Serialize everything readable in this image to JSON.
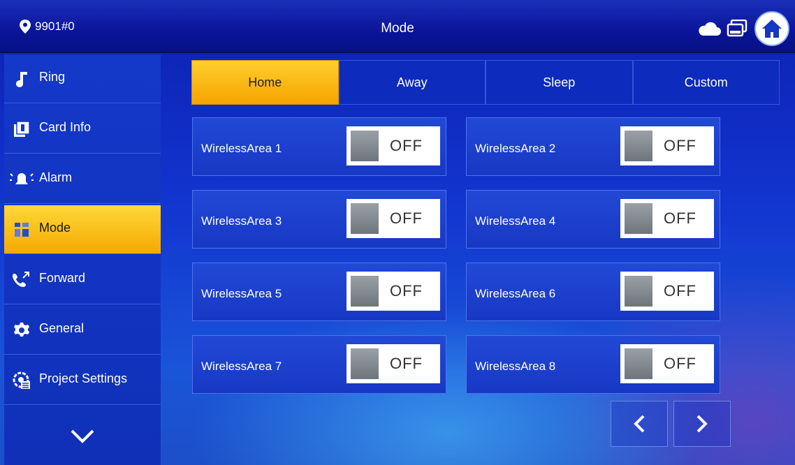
{
  "header": {
    "location": "9901#0",
    "title": "Mode"
  },
  "sidebar": {
    "items": [
      {
        "label": "Ring",
        "icon": "music-note-icon"
      },
      {
        "label": "Card Info",
        "icon": "card-icon"
      },
      {
        "label": "Alarm",
        "icon": "alarm-bell-icon"
      },
      {
        "label": "Mode",
        "icon": "grid-icon",
        "active": true
      },
      {
        "label": "Forward",
        "icon": "forward-call-icon"
      },
      {
        "label": "General",
        "icon": "gear-icon"
      },
      {
        "label": "Project Settings",
        "icon": "project-settings-icon"
      }
    ],
    "more_icon": "chevron-down-icon"
  },
  "tabs": [
    {
      "label": "Home",
      "active": true
    },
    {
      "label": "Away"
    },
    {
      "label": "Sleep"
    },
    {
      "label": "Custom"
    }
  ],
  "areas": [
    {
      "label": "WirelessArea 1",
      "state": "OFF"
    },
    {
      "label": "WirelessArea 2",
      "state": "OFF"
    },
    {
      "label": "WirelessArea 3",
      "state": "OFF"
    },
    {
      "label": "WirelessArea 4",
      "state": "OFF"
    },
    {
      "label": "WirelessArea 5",
      "state": "OFF"
    },
    {
      "label": "WirelessArea 6",
      "state": "OFF"
    },
    {
      "label": "WirelessArea 7",
      "state": "OFF"
    },
    {
      "label": "WirelessArea 8",
      "state": "OFF"
    }
  ],
  "colors": {
    "accent": "#f5a800",
    "panel": "#1438c9"
  }
}
